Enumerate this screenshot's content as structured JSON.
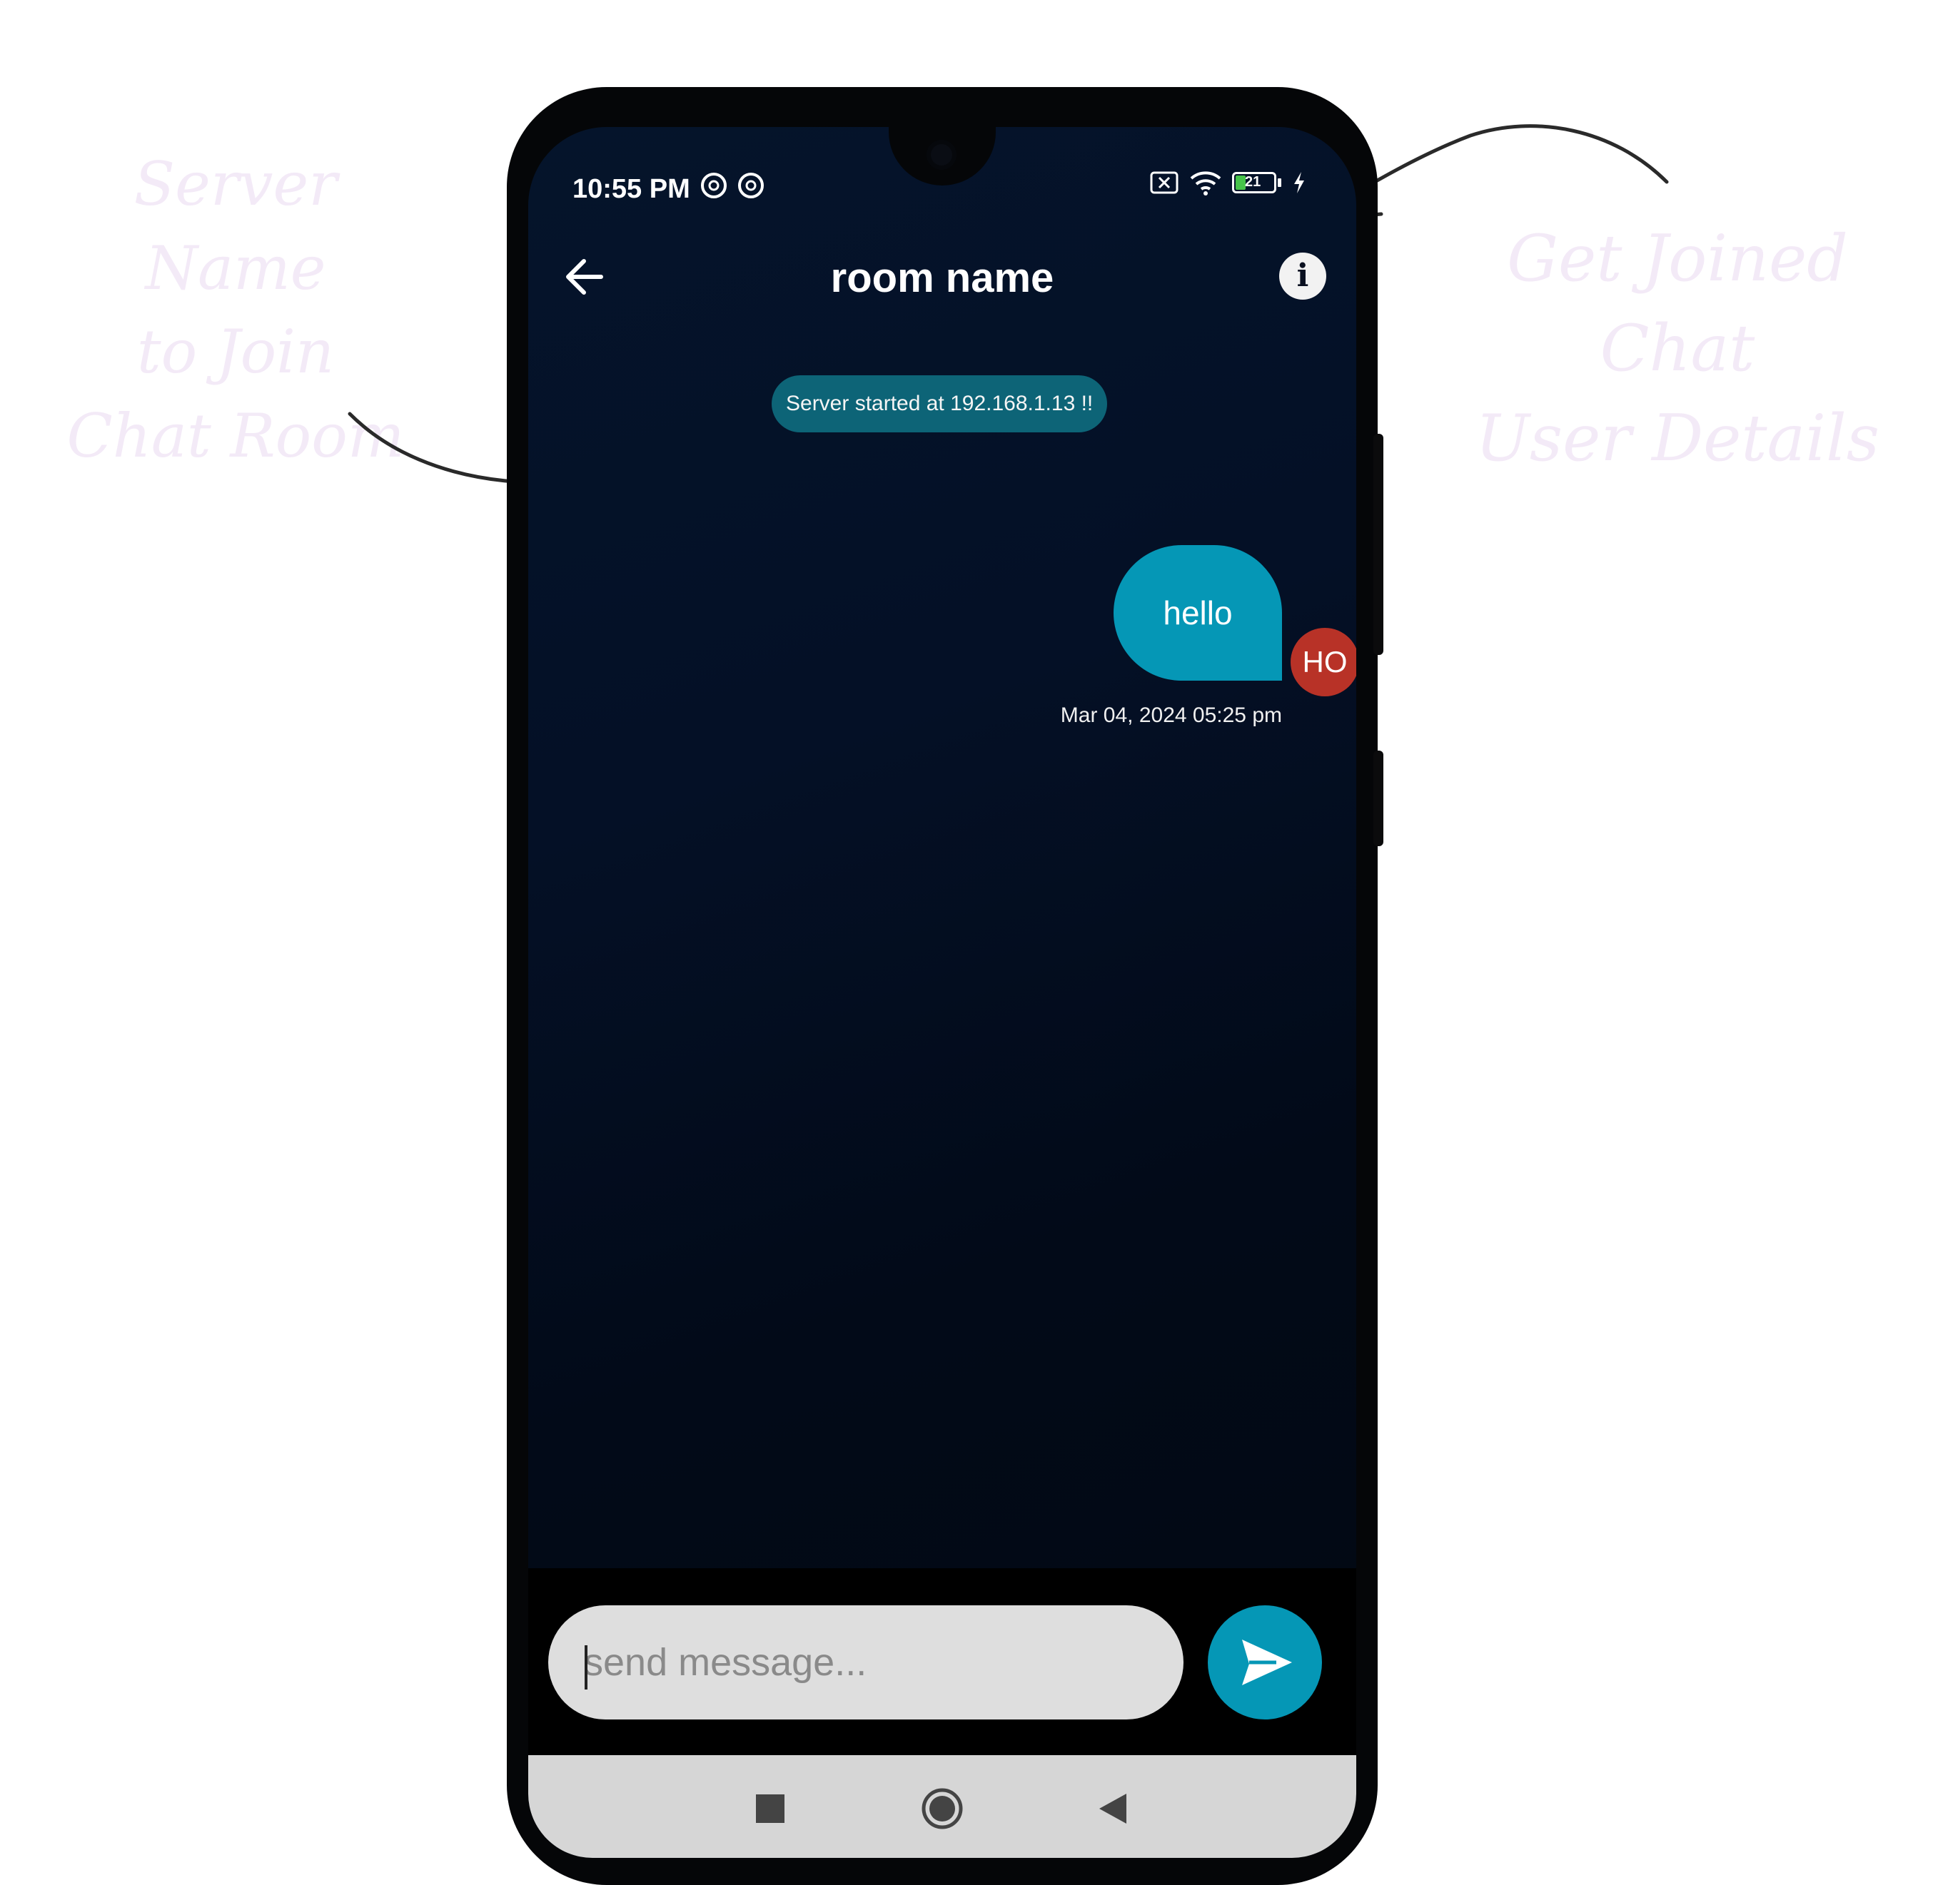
{
  "annotations": {
    "left": "Server Name\nto Join\nChat Room",
    "right": "Get Joined Chat\nUser Details"
  },
  "status_bar": {
    "time": "10:55 PM",
    "battery": "21"
  },
  "header": {
    "title": "room name"
  },
  "system_message": "Server started at 192.168.1.13 !!",
  "messages": [
    {
      "text": "hello",
      "avatar": "HO",
      "timestamp": "Mar 04, 2024 05:25 pm"
    }
  ],
  "composer": {
    "placeholder": "send message..."
  },
  "colors": {
    "accent": "#0597b6",
    "avatar": "#b83227",
    "system_bubble": "#0d6477"
  }
}
